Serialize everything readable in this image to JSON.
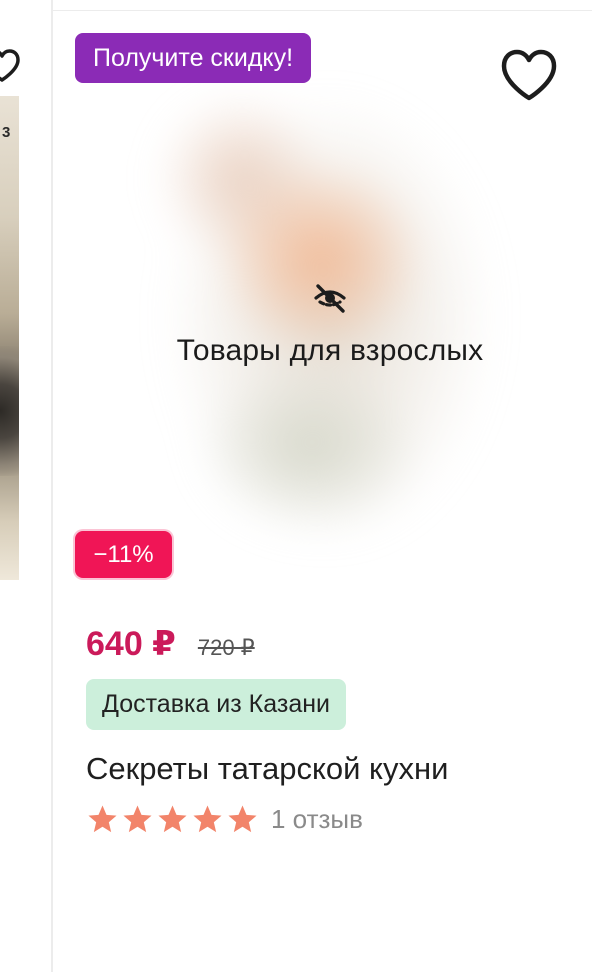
{
  "left_card": {
    "cover_number": "3"
  },
  "product": {
    "promo_badge": "Получите скидку!",
    "adult_notice": "Товары для взрослых",
    "discount_badge": "−11%",
    "price_current": "640 ₽",
    "price_old": "720 ₽",
    "delivery_badge": "Доставка из Казани",
    "title": "Секреты татарской кухни",
    "rating": 5,
    "rating_max": 5,
    "reviews_label": "1 отзыв"
  },
  "icons": {
    "wishlist": "heart-outline-icon",
    "adult_hidden": "eye-slash-icon",
    "rating_star": "star-icon"
  },
  "colors": {
    "promo_purple": "#8b2bb6",
    "discount_red": "#f01556",
    "price_magenta": "#cb1a5a",
    "delivery_green_bg": "#ccefdb",
    "star_orange": "#f2846a"
  }
}
